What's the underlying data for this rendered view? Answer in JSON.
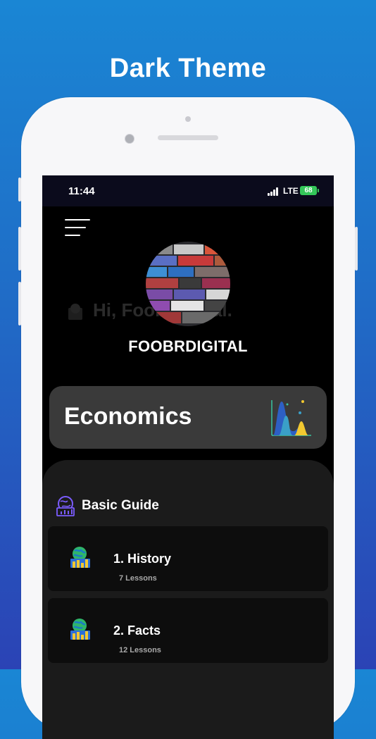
{
  "promo": {
    "title": "Dark Theme"
  },
  "status_bar": {
    "time": "11:44",
    "network": "LTE",
    "battery": "68"
  },
  "background": {
    "ghost_greeting": "Hi, Foobrdigital."
  },
  "profile": {
    "username": "FOOBRDIGITAL"
  },
  "subject": {
    "title": "Economics",
    "icon": "distribution-chart-icon"
  },
  "section": {
    "title": "Basic Guide",
    "icon": "globe-chart-icon"
  },
  "lessons": [
    {
      "title": "1. History",
      "count": "7 Lessons",
      "icon": "globe-bar-chart-icon"
    },
    {
      "title": "2. Facts",
      "count": "12 Lessons",
      "icon": "globe-bar-chart-icon"
    }
  ],
  "colors": {
    "background_top": "#1a86d4",
    "background_bottom": "#2b43b5",
    "screen": "#000000",
    "card": "#3a3a3a",
    "panel": "#1b1b1b",
    "battery": "#34c759"
  }
}
